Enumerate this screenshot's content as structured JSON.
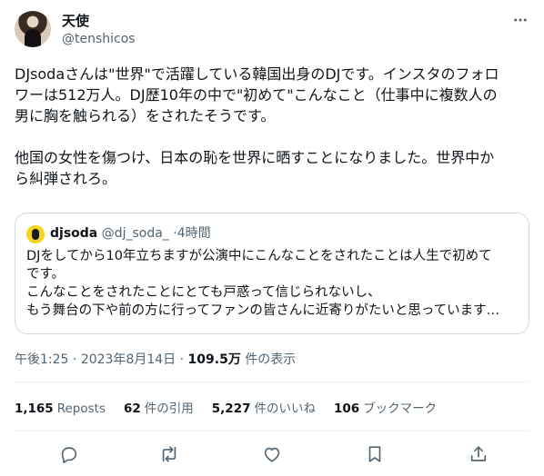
{
  "author": {
    "display_name": "天使",
    "handle": "@tenshicos"
  },
  "tweet": {
    "text": "DJsodaさんは\"世界\"で活躍している韓国出身のDJです。インスタのフォロ\nワーは512万人。DJ歴10年の中で\"初めて\"こんなこと（仕事中に複数人の\n男に胸を触られる）をされたそうです。\n\n他国の女性を傷つけ、日本の恥を世界に晒すことになりました。世界中か\nら糾弾されろ。"
  },
  "quote": {
    "name": "djsoda",
    "handle": "@dj_soda_",
    "separator": "·",
    "time": "4時間",
    "text": "DJをしてから10年立ちますが公演中にこんなことをされたことは人生で初めて\nです。\nこんなことをされたことにとても戸惑って信じられないし、\nもう舞台の下や前の方に行ってファンの皆さんに近寄りがたいと思っています…"
  },
  "meta": {
    "time": "午後1:25",
    "sep1": "·",
    "date": "2023年8月14日",
    "sep2": "·",
    "views": "109.5万",
    "views_label": "件の表示"
  },
  "stats": {
    "reposts_count": "1,165",
    "reposts_label": "Reposts",
    "quotes_count": "62",
    "quotes_label": "件の引用",
    "likes_count": "5,227",
    "likes_label": "件のいいね",
    "bookmarks_count": "106",
    "bookmarks_label": "ブックマーク"
  },
  "icons": {
    "more": "more-horizontal-icon",
    "reply": "reply-icon",
    "repost": "repost-icon",
    "like": "like-icon",
    "bookmark": "bookmark-icon",
    "share": "share-icon"
  },
  "colors": {
    "text": "#0f1419",
    "secondary": "#536471",
    "border": "#cfd9de"
  }
}
